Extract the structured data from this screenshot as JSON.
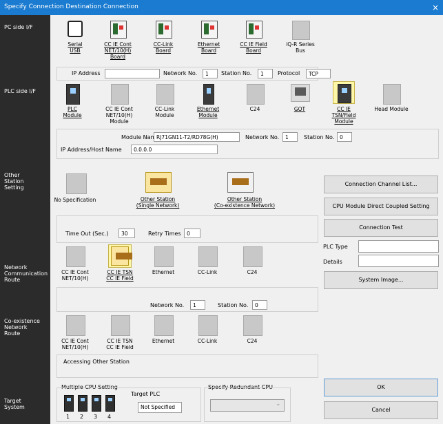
{
  "window": {
    "title": "Specify Connection Destination Connection",
    "close": "×"
  },
  "sections": {
    "pc": "PC side I/F",
    "plc": "PLC side I/F",
    "other": [
      "Other",
      "Station",
      "Setting"
    ],
    "network": [
      "Network",
      "Communication",
      "Route"
    ],
    "coexist": [
      "Co-existence",
      "Network",
      "Route"
    ],
    "target": [
      "Target",
      "System"
    ]
  },
  "pc_side": {
    "items": [
      {
        "lines": [
          "Serial",
          "USB"
        ],
        "icon": "usb-icon"
      },
      {
        "lines": [
          "CC IE Cont",
          "NET/10(H)",
          "Board"
        ],
        "icon": "board-icon"
      },
      {
        "lines": [
          "CC-Link",
          "Board"
        ],
        "icon": "board-icon"
      },
      {
        "lines": [
          "Ethernet",
          "Board"
        ],
        "icon": "board-icon"
      },
      {
        "lines": [
          "CC IE Field",
          "Board"
        ],
        "icon": "board-icon"
      },
      {
        "lines": [
          "iQ-R Series",
          "Bus"
        ],
        "icon": "bus-icon"
      }
    ],
    "ip_label": "IP Address",
    "ip_value": "",
    "network_label": "Network No.",
    "network_value": "1",
    "station_label": "Station No.",
    "station_value": "1",
    "protocol_label": "Protocol",
    "protocol_value": "TCP"
  },
  "plc_side": {
    "items": [
      {
        "lines": [
          "PLC",
          "Module"
        ]
      },
      {
        "lines": [
          "CC IE Cont",
          "NET/10(H)",
          "Module"
        ]
      },
      {
        "lines": [
          "CC-Link",
          "Module"
        ]
      },
      {
        "lines": [
          "Ethernet",
          "Module"
        ]
      },
      {
        "lines": [
          "C24"
        ]
      },
      {
        "lines": [
          "GOT"
        ]
      },
      {
        "lines": [
          "CC IE",
          "TSN/Field",
          "Module"
        ]
      },
      {
        "lines": [
          "Head Module"
        ]
      }
    ],
    "module_name_label": "Module Name",
    "module_name_value": "RJ71GN11-T2/RD78G(H)",
    "network_label": "Network No.",
    "network_value": "1",
    "station_label": "Station No.",
    "station_value": "0",
    "ip_host_label": "IP Address/Host Name",
    "ip_host_value": "0.0.0.0"
  },
  "other_station": {
    "items": [
      {
        "lines": [
          "No Specification"
        ]
      },
      {
        "lines": [
          "Other Station",
          "(Single Network)"
        ]
      },
      {
        "lines": [
          "Other Station",
          "(Co-existence Network)"
        ]
      }
    ],
    "timeout_label": "Time Out (Sec.)",
    "timeout_value": "30",
    "retry_label": "Retry Times",
    "retry_value": "0"
  },
  "network_route": {
    "items": [
      {
        "lines": [
          "CC IE Cont",
          "NET/10(H)"
        ]
      },
      {
        "lines": [
          "CC IE TSN",
          "CC IE Field"
        ]
      },
      {
        "lines": [
          "Ethernet"
        ]
      },
      {
        "lines": [
          "CC-Link"
        ]
      },
      {
        "lines": [
          "C24"
        ]
      }
    ],
    "network_label": "Network No.",
    "network_value": "1",
    "station_label": "Station No.",
    "station_value": "0"
  },
  "coexist_route": {
    "items": [
      {
        "lines": [
          "CC IE Cont",
          "NET/10(H)"
        ]
      },
      {
        "lines": [
          "CC IE TSN",
          "CC IE Field"
        ]
      },
      {
        "lines": [
          "Ethernet"
        ]
      },
      {
        "lines": [
          "CC-Link"
        ]
      },
      {
        "lines": [
          "C24"
        ]
      }
    ],
    "accessing_label": "Accessing Other Station"
  },
  "target_system": {
    "multiple_cpu_label": "Multiple CPU Setting",
    "cpu_numbers": [
      "1",
      "2",
      "3",
      "4"
    ],
    "target_plc_label": "Target PLC",
    "target_plc_value": "Not Specified",
    "redundant_label": "Specify Redundant CPU",
    "redundant_value": ""
  },
  "right_panel": {
    "channel_list": "Connection Channel List...",
    "direct_coupled": "CPU Module Direct Coupled Setting",
    "connection_test": "Connection Test",
    "plc_type_label": "PLC Type",
    "plc_type_value": "",
    "details_label": "Details",
    "details_value": "",
    "system_image": "System Image...",
    "ok": "OK",
    "cancel": "Cancel"
  },
  "colors": {
    "titlebar": "#1a7bd0",
    "sidebar": "#2b2b2b",
    "selected": "#fff7a8"
  }
}
